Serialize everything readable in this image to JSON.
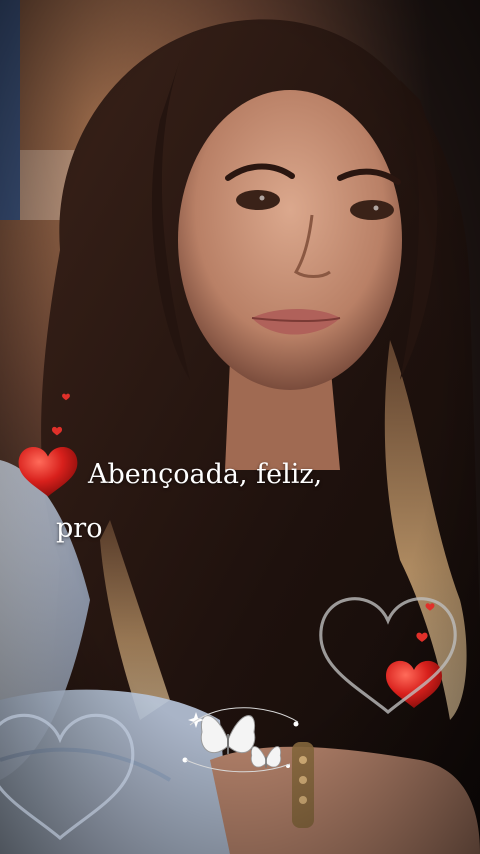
{
  "caption": {
    "line1": "Abençoada, feliz,",
    "line2": "pro"
  },
  "colors": {
    "background": "#1a1210",
    "hair": "#2a1713",
    "skin": "#c9957a",
    "heart_red": "#d8201c",
    "heart_outline": "#bfbfbf",
    "butterfly": "#f2f2f2",
    "text": "#ffffff"
  },
  "icons": [
    "heart-icon",
    "heart-outline-icon",
    "butterfly-icon",
    "sparkle-icon"
  ]
}
